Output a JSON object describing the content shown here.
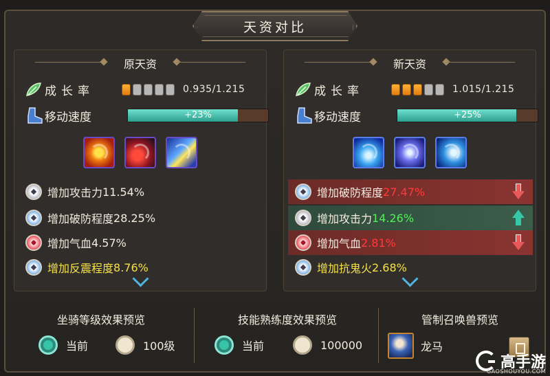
{
  "title": "天资对比",
  "panels": [
    {
      "header": "原天资",
      "growth_label": "成长率",
      "growth_pips_on": 1,
      "growth_pips_total": 5,
      "growth_value": "0.935/1.215",
      "speed_label": "移动速度",
      "speed_text": "+23%",
      "speed_fill": 0.23,
      "skills": [
        "fire-skill-icon",
        "slash-skill-icon",
        "thunder-skill-icon"
      ],
      "attributes": [
        {
          "icon": "sword-icon",
          "name": "增加攻击力",
          "value": "11.54%",
          "style": "normal"
        },
        {
          "icon": "pierce-icon",
          "name": "增加破防程度",
          "value": "28.25%",
          "style": "normal"
        },
        {
          "icon": "heart-icon",
          "name": "增加气血",
          "value": "4.57%",
          "style": "normal"
        },
        {
          "icon": "shock-icon",
          "name": "增加反震程度",
          "value": "8.76%",
          "style": "yellow"
        }
      ]
    },
    {
      "header": "新天资",
      "growth_label": "成长率",
      "growth_pips_on": 3,
      "growth_pips_total": 5,
      "growth_value": "1.015/1.215",
      "speed_label": "移动速度",
      "speed_text": "+25%",
      "speed_fill": 0.25,
      "skills": [
        "water-skill-icon",
        "ice-skill-icon",
        "wave-skill-icon"
      ],
      "attributes": [
        {
          "icon": "pierce-icon",
          "name": "增加破防程度",
          "value": "27.47%",
          "style": "bad"
        },
        {
          "icon": "sword-icon",
          "name": "增加攻击力",
          "value": "14.26%",
          "style": "good"
        },
        {
          "icon": "heart-icon",
          "name": "增加气血",
          "value": "2.81%",
          "style": "bad"
        },
        {
          "icon": "shock-icon",
          "name": "增加抗鬼火",
          "value": "2.68%",
          "style": "yellow"
        }
      ]
    }
  ],
  "bottom": {
    "mount": {
      "title": "坐骑等级效果预览",
      "opt_current": "当前",
      "opt_other": "100级"
    },
    "skill": {
      "title": "技能熟练度效果预览",
      "opt_current": "当前",
      "opt_other": "100000"
    },
    "summon": {
      "title": "管制召唤兽预览",
      "name": "龙马"
    }
  },
  "watermark": {
    "text": "高手游",
    "domain": "GAOSHOUYOU.COM"
  },
  "colors": {
    "accent_teal": "#37c4a8",
    "decrease_red": "#ff3a3a",
    "increase_green": "#56ef5a",
    "highlight_yellow": "#f5e24a"
  }
}
